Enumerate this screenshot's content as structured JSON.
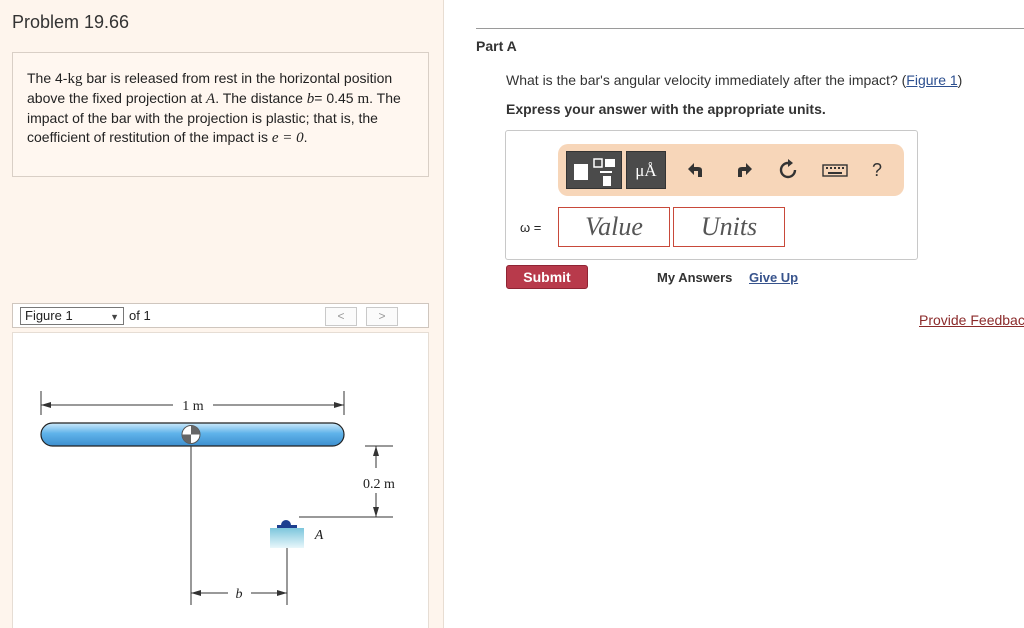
{
  "problem": {
    "title": "Problem 19.66",
    "text_1": "The 4-",
    "mass_unit": "kg",
    "text_2": " bar is released from rest in the horizontal position above the fixed projection at ",
    "point": "A",
    "text_3": ". The distance ",
    "dist_var": "b",
    "text_4": "= 0.45 ",
    "dist_unit": "m",
    "text_5": ". The impact of the bar with the projection is plastic; that is, the coefficient of restitution of the impact is ",
    "coef": "e = 0",
    "text_6": "."
  },
  "figure_nav": {
    "selected": "Figure 1",
    "caret": "▼",
    "of_label": "of 1",
    "prev": "<",
    "next": ">"
  },
  "figure": {
    "bar_length_label": "1 m",
    "height_label": "0.2 m",
    "point_label": "A",
    "distance_label": "b",
    "bar_color": "#5fb3ea",
    "support_color": "#9fd8e6"
  },
  "part": {
    "title": "Part A",
    "question": "What is the bar's angular velocity immediately after the impact? (",
    "question_link": "Figure 1",
    "question_end": ")",
    "instruction": "Express your answer with the appropriate units."
  },
  "answer": {
    "variable_label": "ω =",
    "value_placeholder": "Value",
    "units_placeholder": "Units",
    "toolbar": {
      "units_button": "μÅ",
      "help": "?"
    }
  },
  "actions": {
    "submit": "Submit",
    "my_answers": "My Answers",
    "give_up": "Give Up",
    "feedback": "Provide Feedback"
  },
  "colors": {
    "submit_bg": "#b83a4b",
    "toolbar_bg": "#f7d6b9",
    "input_border": "#c8493a",
    "link": "#2c4f8f"
  }
}
